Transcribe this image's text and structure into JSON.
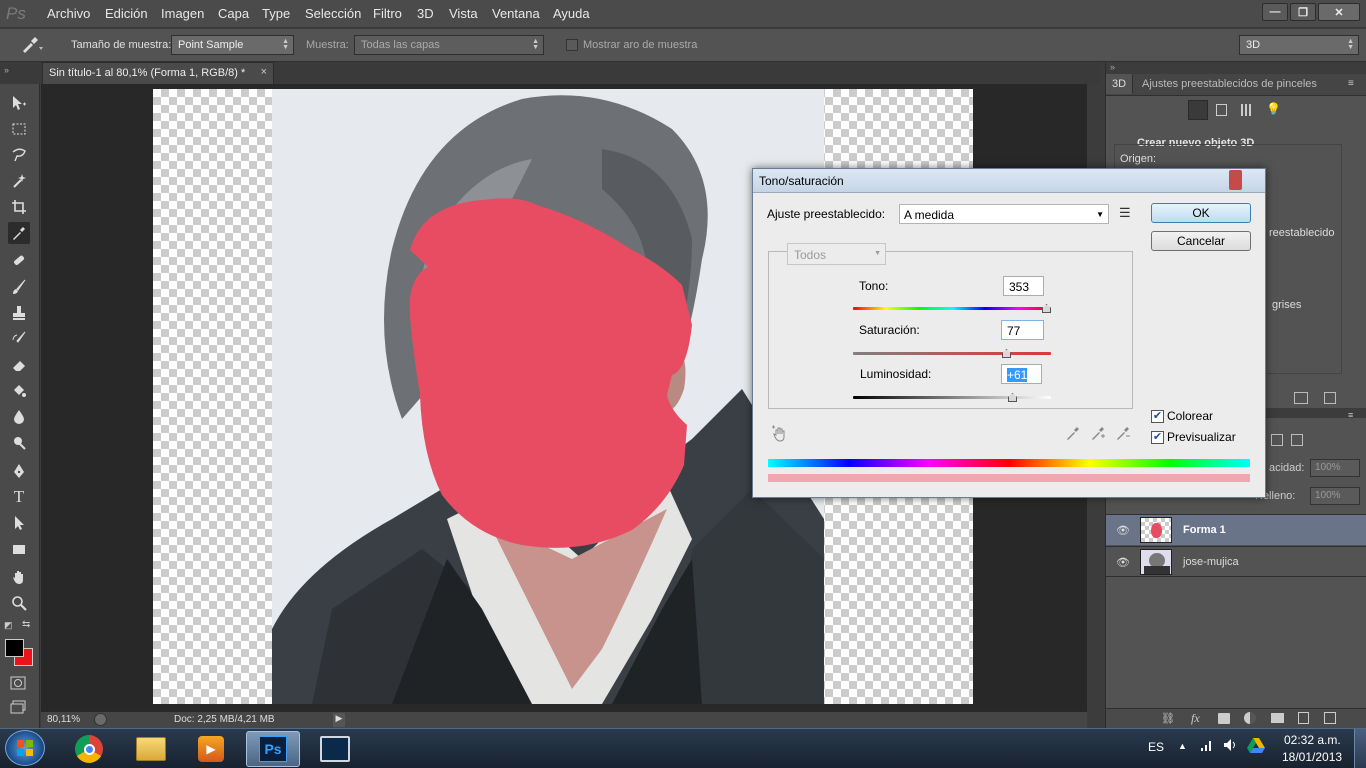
{
  "app": {
    "logo": "Ps"
  },
  "menu": [
    "Archivo",
    "Edición",
    "Imagen",
    "Capa",
    "Type",
    "Selección",
    "Filtro",
    "3D",
    "Vista",
    "Ventana",
    "Ayuda"
  ],
  "window_controls": {
    "minimize": "—",
    "restore": "❐",
    "close": "✕"
  },
  "options": {
    "sample_size_label": "Tamaño de muestra:",
    "sample_size_value": "Point Sample",
    "sample_label": "Muestra:",
    "sample_value": "Todas las capas",
    "show_ring_label": "Mostrar aro de muestra",
    "workspace_value": "3D"
  },
  "document": {
    "tab_title": "Sin título-1 al 80,1% (Forma 1, RGB/8) *",
    "tab_close": "×",
    "zoom": "80,11%",
    "doc_info": "Doc: 2,25 MB/4,21 MB"
  },
  "panels": {
    "tab_3d": "3D",
    "tab_brush_presets": "Ajustes preestablecidos de pinceles",
    "create_3d_title": "Crear nuevo objeto 3D",
    "origin_label": "Origen:",
    "partial_preset": "reestablecido",
    "partial_grays": "grises",
    "opacity_label": "acidad:",
    "opacity_value": "100%",
    "fill_label": "Relleno:",
    "fill_value": "100%"
  },
  "layers": [
    {
      "name": "Forma 1",
      "selected": true
    },
    {
      "name": "jose-mujica",
      "selected": false
    }
  ],
  "dialog": {
    "title": "Tono/saturación",
    "preset_label": "Ajuste preestablecido:",
    "preset_value": "A medida",
    "channel_value": "Todos",
    "ok_label": "OK",
    "cancel_label": "Cancelar",
    "hue_label": "Tono:",
    "hue_value": "353",
    "saturation_label": "Saturación:",
    "saturation_value": "77",
    "lightness_label": "Luminosidad:",
    "lightness_value": "+61",
    "colorize_label": "Colorear",
    "colorize_checked": true,
    "preview_label": "Previsualizar",
    "preview_checked": true,
    "colorize_color": "#e84c62"
  },
  "taskbar": {
    "language": "ES",
    "time": "02:32 a.m.",
    "date": "18/01/2013",
    "ps_label": "Ps"
  },
  "colors": {
    "foreground": "#000000",
    "background": "#e8151b",
    "shape_fill": "#e84c62"
  }
}
